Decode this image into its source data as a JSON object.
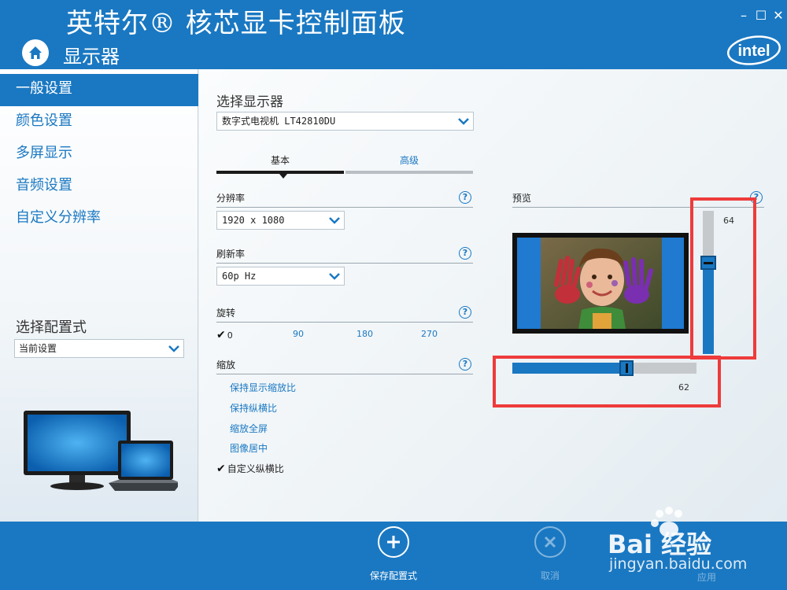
{
  "window": {
    "title": "英特尔® 核芯显卡控制面板",
    "section": "显示器",
    "controls": {
      "minimize": "–",
      "maximize": "☐",
      "close": "✕"
    },
    "logo_text": "intel"
  },
  "sidebar": {
    "items": [
      {
        "label": "一般设置",
        "active": true
      },
      {
        "label": "颜色设置"
      },
      {
        "label": "多屏显示"
      },
      {
        "label": "音频设置"
      },
      {
        "label": "自定义分辨率"
      }
    ],
    "config_label": "选择配置式",
    "config_value": "当前设置"
  },
  "main": {
    "select_display_label": "选择显示器",
    "display_value": "数字式电视机 LT42810DU",
    "tabs": [
      {
        "label": "基本",
        "active": true
      },
      {
        "label": "高级"
      }
    ],
    "resolution": {
      "label": "分辨率",
      "value": "1920 x 1080"
    },
    "refresh": {
      "label": "刷新率",
      "value": "60p Hz"
    },
    "rotation": {
      "label": "旋转",
      "options": [
        "0",
        "90",
        "180",
        "270"
      ],
      "selected": "0"
    },
    "scaling": {
      "label": "缩放",
      "options": [
        "保持显示缩放比",
        "保持纵横比",
        "缩放全屏",
        "图像居中",
        "自定义纵横比"
      ],
      "selected": "自定义纵横比"
    },
    "help_glyph": "?",
    "preview": {
      "label": "预览",
      "vertical_value": "64",
      "horizontal_value": "62",
      "vertical_level": 64,
      "horizontal_level": 62
    }
  },
  "footer": {
    "save_label": "保存配置式",
    "cancel_label": "取消",
    "apply_label": "应用"
  },
  "watermark": {
    "text": "Bai 经验",
    "url_text": "jingyan.baidu.com"
  },
  "colors": {
    "accent": "#1a78c2",
    "highlight": "#ee3b3b"
  }
}
